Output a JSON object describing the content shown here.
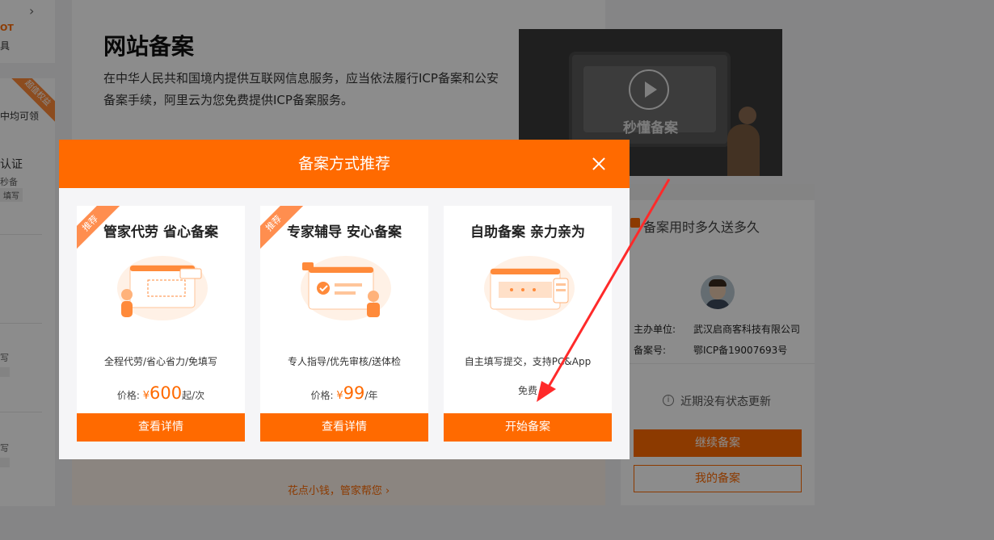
{
  "background": {
    "left_sidebar": {
      "partial_ot": "OT",
      "partial_ju": "具",
      "ribbon": "超值权益",
      "partial_t1": "中均可领",
      "partial_t2": "认证",
      "partial_t3": "秒备",
      "partial_tag": "填写",
      "partial_small_1": "写",
      "partial_small_2": "写"
    },
    "main": {
      "title": "网站备案",
      "description": "在中华人民共和国境内提供互联网信息服务，应当依法履行ICP备案和公安备案手续，阿里云为您免费提供ICP备案服务。",
      "help_link": "花点小钱，管家帮您 ›"
    },
    "video": {
      "label": "秒懂备案"
    },
    "right_panel": {
      "promo": "备案用时多久送多久",
      "host_label": "主办单位:",
      "host_value": "武汉启商客科技有限公司",
      "record_label": "备案号:",
      "record_value": "鄂ICP备19007693号",
      "status": "近期没有状态更新",
      "continue_button": "继续备案",
      "my_records_button": "我的备案"
    }
  },
  "modal": {
    "title": "备案方式推荐",
    "options": [
      {
        "ribbon": "推荐",
        "title": "管家代劳 省心备案",
        "description": "全程代劳/省心省力/免填写",
        "price_label": "价格:",
        "price_currency": "¥",
        "price_value": "600",
        "price_unit": "起/次",
        "button": "查看详情"
      },
      {
        "ribbon": "推荐",
        "title": "专家辅导 安心备案",
        "description": "专人指导/优先审核/送体检",
        "price_label": "价格:",
        "price_currency": "¥",
        "price_value": "99",
        "price_unit": "/年",
        "button": "查看详情"
      },
      {
        "title": "自助备案 亲力亲为",
        "description": "自主填写提交，支持PC&App",
        "price_free": "免费",
        "button": "开始备案"
      }
    ]
  },
  "colors": {
    "brand": "#ff6a00",
    "annotation_arrow": "#ff2a2a"
  }
}
